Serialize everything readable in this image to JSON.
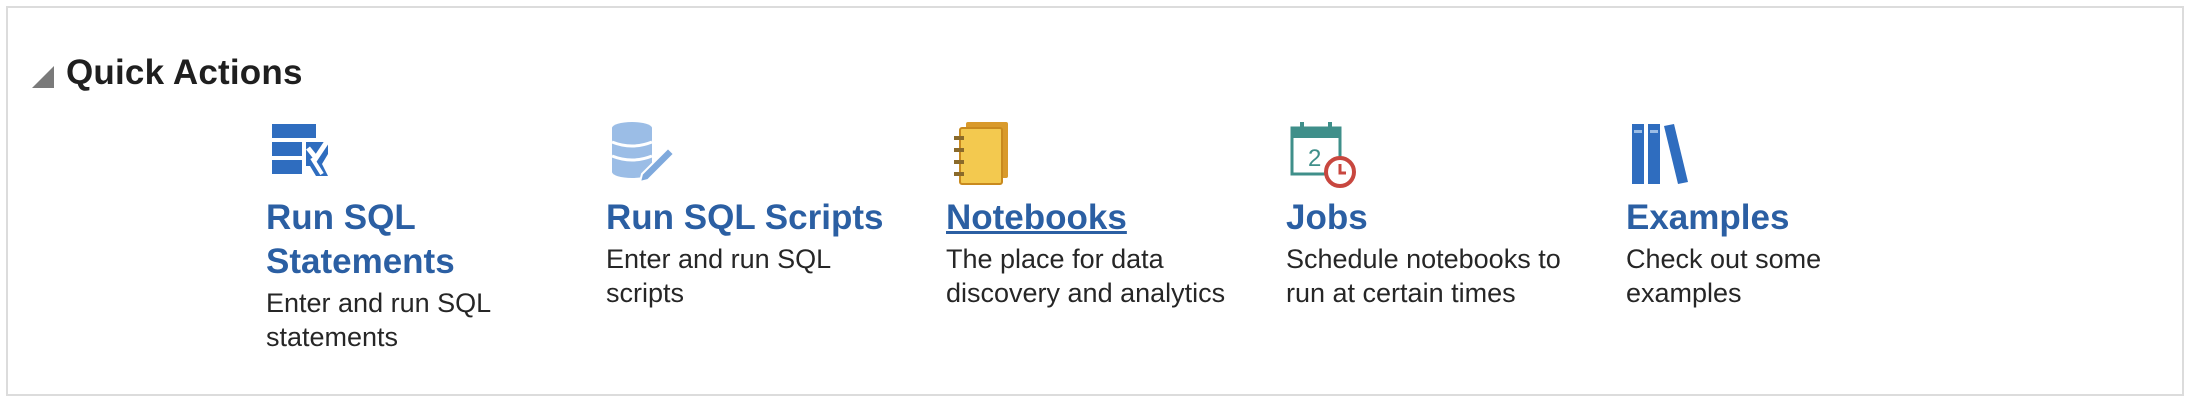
{
  "section": {
    "title": "Quick Actions"
  },
  "actions": [
    {
      "title": "Run SQL Statements",
      "description": "Enter and run SQL statements",
      "icon": "sql-statement-icon"
    },
    {
      "title": "Run SQL Scripts",
      "description": "Enter and run SQL scripts",
      "icon": "database-edit-icon"
    },
    {
      "title": "Notebooks",
      "description": "The place for data discovery and analytics",
      "icon": "notebook-icon"
    },
    {
      "title": "Jobs",
      "description": "Schedule notebooks to run at certain times",
      "icon": "calendar-clock-icon"
    },
    {
      "title": "Examples",
      "description": "Check out some examples",
      "icon": "books-icon"
    }
  ],
  "colors": {
    "link": "#2b5fa3",
    "text": "#262626",
    "border": "#dcdcdc"
  }
}
